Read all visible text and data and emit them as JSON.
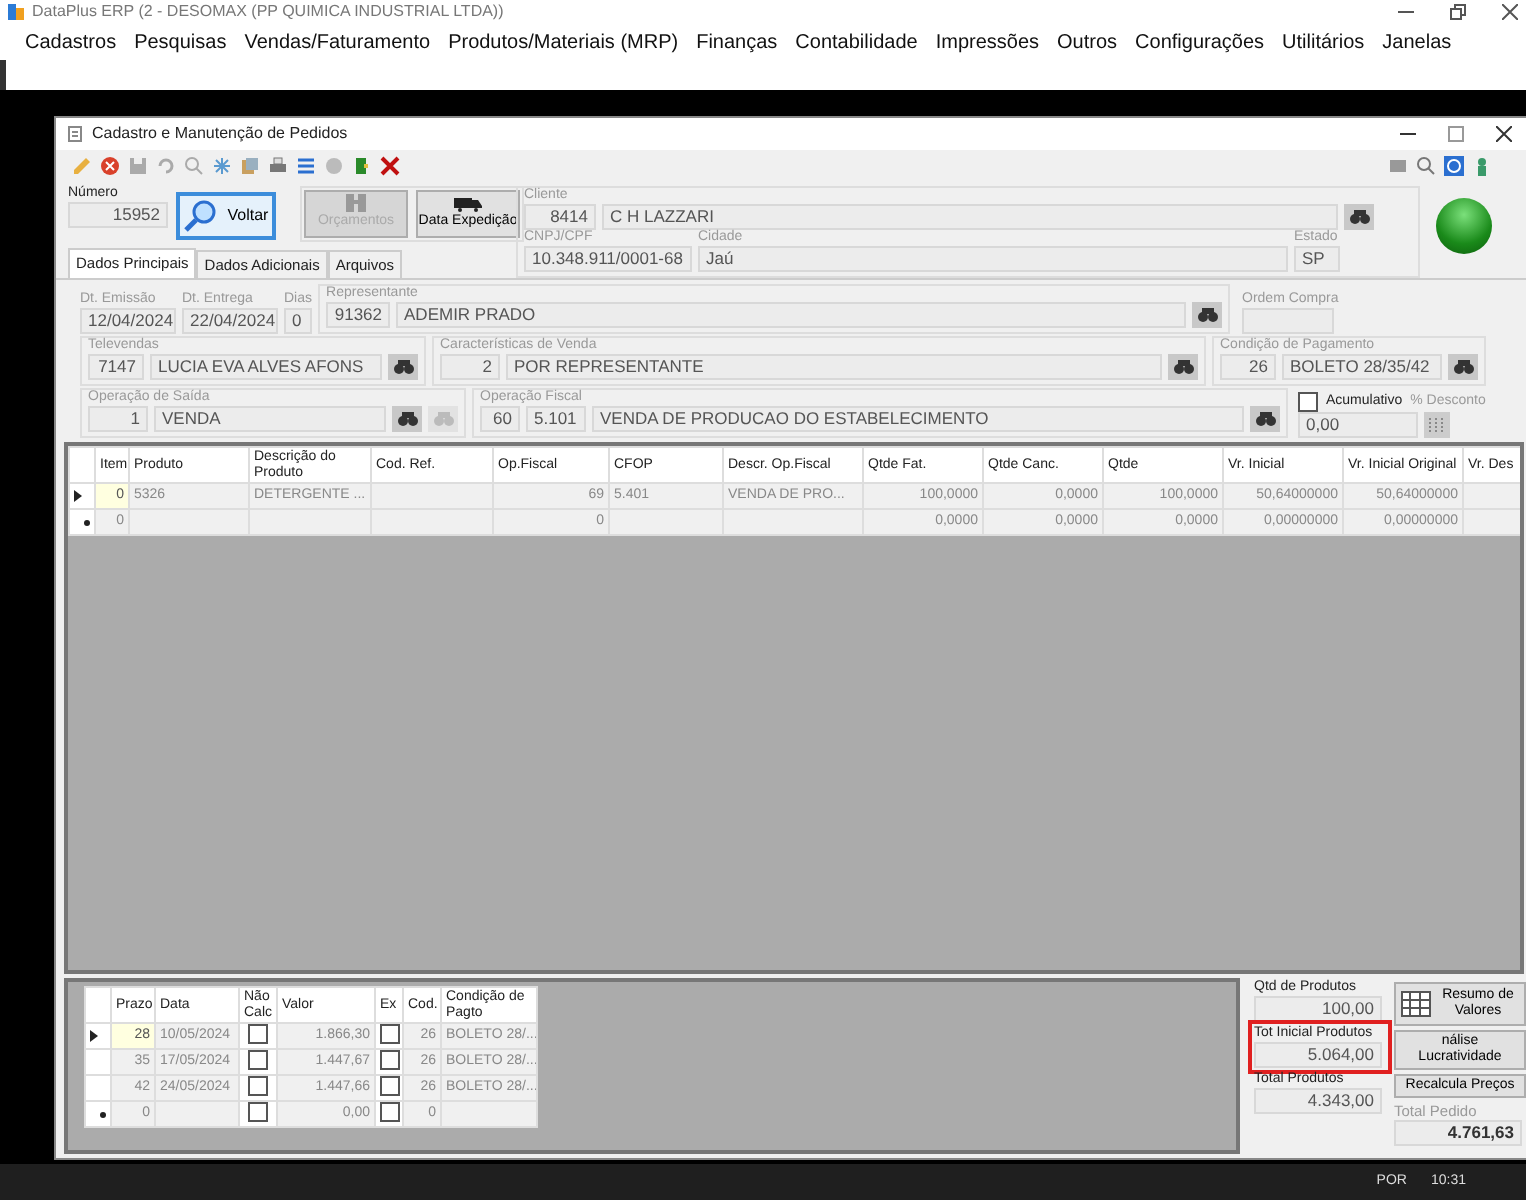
{
  "app": {
    "title": "DataPlus ERP (2 - DESOMAX  (PP QUIMICA INDUSTRIAL LTDA))",
    "menu": [
      "Cadastros",
      "Pesquisas",
      "Vendas/Faturamento",
      "Produtos/Materiais (MRP)",
      "Finanças",
      "Contabilidade",
      "Impressões",
      "Outros",
      "Configurações",
      "Utilitários",
      "Janelas"
    ]
  },
  "form": {
    "title": "Cadastro e Manutenção de Pedidos",
    "numero": {
      "label": "Número",
      "value": "15952"
    },
    "buttons": [
      {
        "label": "Voltar",
        "kind": "search",
        "disabled": false
      },
      {
        "label": "Orçamentos",
        "kind": "budget",
        "disabled": true
      },
      {
        "label": "Data Expedição",
        "kind": "truck",
        "disabled": false
      }
    ],
    "cliente": {
      "label": "Cliente",
      "code": "8414",
      "name": "C H LAZZARI"
    },
    "cnpj": {
      "label": "CNPJ/CPF",
      "value": "10.348.911/0001-68"
    },
    "cidade": {
      "label": "Cidade",
      "value": "Jaú"
    },
    "estado": {
      "label": "Estado",
      "value": "SP"
    },
    "tabs": [
      {
        "label": "Dados Principais",
        "selected": true
      },
      {
        "label": "Dados Adicionais",
        "selected": false
      },
      {
        "label": "Arquivos",
        "selected": false
      }
    ],
    "emissao": {
      "label": "Dt. Emissão",
      "value": "12/04/2024"
    },
    "entrega": {
      "label": "Dt. Entrega",
      "value": "22/04/2024"
    },
    "dias": {
      "label": "Dias",
      "value": "0"
    },
    "representante": {
      "label": "Representante",
      "code": "91362",
      "name": "ADEMIR PRADO"
    },
    "ordem_compra": {
      "label": "Ordem Compra"
    },
    "televendas": {
      "label": "Televendas",
      "code": "7147",
      "name": "LUCIA EVA ALVES AFONS"
    },
    "caracteristicas": {
      "label": "Características de Venda",
      "code": "2",
      "name": "POR REPRESENTANTE"
    },
    "condicao": {
      "label": "Condição de Pagamento",
      "code": "26",
      "name": "BOLETO 28/35/42"
    },
    "operacao_saida": {
      "label": "Operação de Saída",
      "code": "1",
      "name": "VENDA"
    },
    "operacao_fiscal": {
      "label": "Operação Fiscal",
      "code": "60",
      "cfop": "5.101",
      "name": "VENDA DE PRODUCAO DO ESTABELECIMENTO"
    },
    "acumulativo": {
      "label": "Acumulativo",
      "checked": false
    },
    "desconto": {
      "label": "% Desconto",
      "value": "0,00"
    },
    "items": {
      "columns": [
        "Item",
        "Produto",
        "Descrição do Produto",
        "Cod. Ref.",
        "Op.Fiscal",
        "CFOP",
        "Descr. Op.Fiscal",
        "Qtde Fat.",
        "Qtde Canc.",
        "Qtde",
        "Vr. Inicial",
        "Vr. Inicial Original",
        "Vr. Des"
      ],
      "rows": [
        {
          "current": true,
          "new_row": false,
          "cells": [
            "0",
            "5326",
            "DETERGENTE ...",
            null,
            "69",
            "5.401",
            "VENDA DE PRO...",
            "100,0000",
            "0,0000",
            "100,0000",
            "50,64000000",
            "50,64000000",
            null
          ]
        },
        {
          "current": false,
          "new_row": true,
          "cells": [
            "0",
            null,
            null,
            null,
            "0",
            null,
            null,
            "0,0000",
            "0,0000",
            "0,0000",
            "0,00000000",
            "0,00000000",
            null
          ]
        }
      ]
    },
    "installments": {
      "columns": [
        "Prazo",
        "Data",
        "Não Calc",
        "Valor",
        "Ex",
        "Cod.",
        "Condição de Pagto"
      ],
      "rows": [
        {
          "current": true,
          "new_row": false,
          "prazo": "28",
          "data": "10/05/2024",
          "nao_calc": false,
          "valor": "1.866,30",
          "ex": false,
          "cod": "26",
          "condicao": "BOLETO 28/..."
        },
        {
          "current": false,
          "new_row": false,
          "prazo": "35",
          "data": "17/05/2024",
          "nao_calc": false,
          "valor": "1.447,67",
          "ex": false,
          "cod": "26",
          "condicao": "BOLETO 28/..."
        },
        {
          "current": false,
          "new_row": false,
          "prazo": "42",
          "data": "24/05/2024",
          "nao_calc": false,
          "valor": "1.447,66",
          "ex": false,
          "cod": "26",
          "condicao": "BOLETO 28/..."
        },
        {
          "current": false,
          "new_row": true,
          "prazo": "0",
          "nao_calc": false,
          "valor": "0,00",
          "ex": false,
          "cod": "0"
        }
      ]
    },
    "totals": {
      "qtd": {
        "label": "Qtd de Produtos",
        "value": "100,00"
      },
      "tot_inicial": {
        "label": "Tot Inicial Produtos",
        "value": "5.064,00",
        "highlighted": true
      },
      "total_produtos": {
        "label": "Total Produtos",
        "value": "4.343,00"
      },
      "actions": [
        {
          "label": "Resumo de Valores",
          "kind": "grid"
        },
        {
          "label": "nálise Lucratividade",
          "kind": "plain"
        },
        {
          "label": "Recalcula Preços",
          "kind": "plain"
        }
      ],
      "total_pedido": {
        "label": "Total Pedido",
        "value": "4.761,63"
      }
    }
  },
  "taskbar": {
    "language": "POR",
    "time": "10:31"
  }
}
